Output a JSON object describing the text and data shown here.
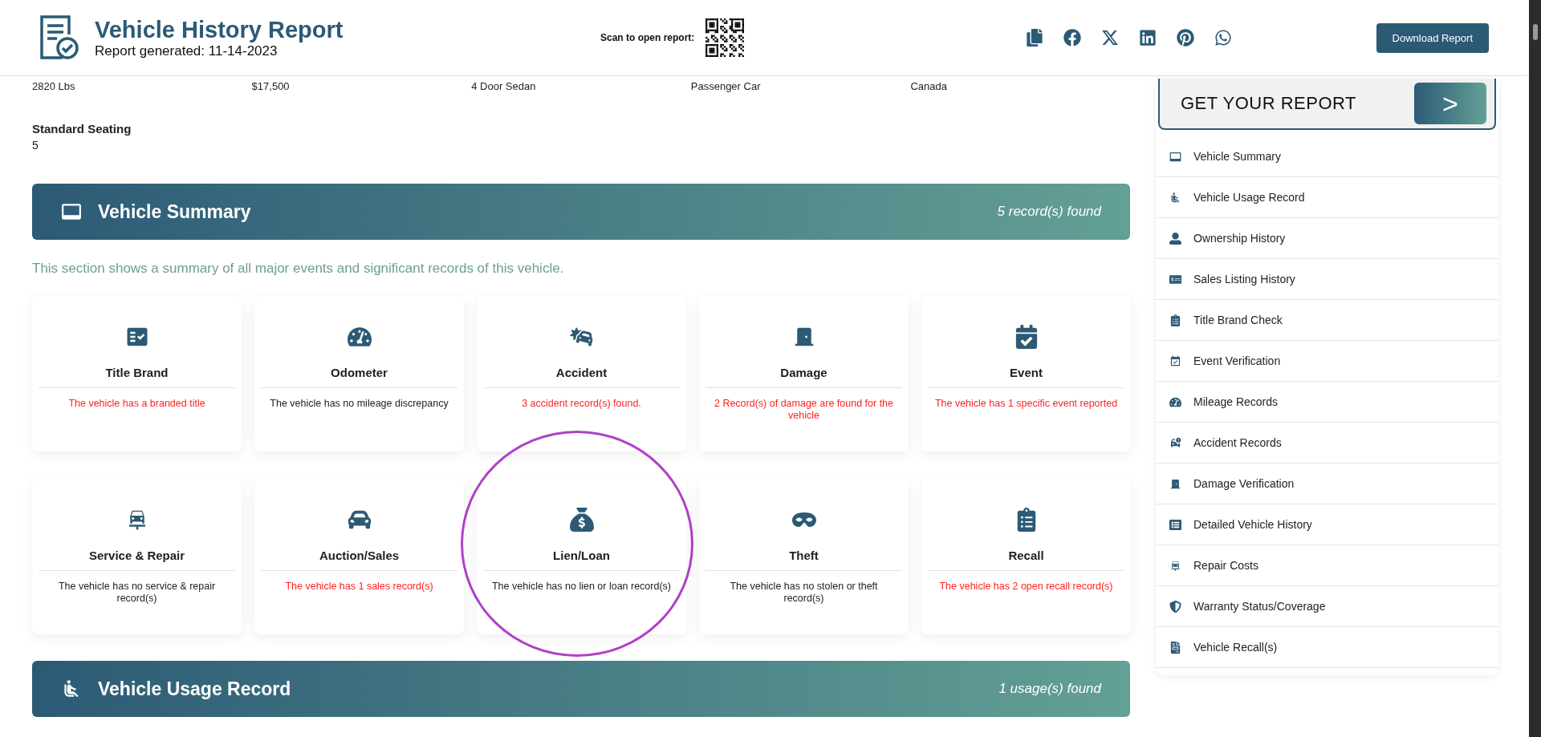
{
  "header": {
    "title": "Vehicle History Report",
    "generated": "Report generated: 11-14-2023",
    "qr_label": "Scan to open report:",
    "download_button": "Download Report"
  },
  "specs": [
    "2820 Lbs",
    "$17,500",
    "4 Door Sedan",
    "Passenger Car",
    "Canada"
  ],
  "seating": {
    "label": "Standard Seating",
    "value": "5"
  },
  "summary": {
    "title": "Vehicle Summary",
    "count": "5 record(s) found",
    "description": "This section shows a summary of all major events and significant records of this vehicle."
  },
  "cards": [
    {
      "title": "Title Brand",
      "text": "The vehicle has a branded title",
      "alert": true,
      "highlighted": false
    },
    {
      "title": "Odometer",
      "text": "The vehicle has no mileage discrepancy",
      "alert": false,
      "highlighted": false
    },
    {
      "title": "Accident",
      "text": "3 accident record(s) found.",
      "alert": true,
      "highlighted": false
    },
    {
      "title": "Damage",
      "text": "2 Record(s) of damage are found for the vehicle",
      "alert": true,
      "highlighted": false
    },
    {
      "title": "Event",
      "text": "The vehicle has 1 specific event reported",
      "alert": true,
      "highlighted": false
    },
    {
      "title": "Service & Repair",
      "text": "The vehicle has no service & repair record(s)",
      "alert": false,
      "highlighted": false
    },
    {
      "title": "Auction/Sales",
      "text": "The vehicle has 1 sales record(s)",
      "alert": true,
      "highlighted": false
    },
    {
      "title": "Lien/Loan",
      "text": "The vehicle has no lien or loan record(s)",
      "alert": false,
      "highlighted": true
    },
    {
      "title": "Theft",
      "text": "The vehicle has no stolen or theft record(s)",
      "alert": false,
      "highlighted": false
    },
    {
      "title": "Recall",
      "text": "The vehicle has 2 open recall record(s)",
      "alert": true,
      "highlighted": false
    }
  ],
  "usage": {
    "title": "Vehicle Usage Record",
    "count": "1 usage(s) found"
  },
  "sidebar": {
    "cta": "GET YOUR REPORT",
    "cta_button": ">",
    "items": [
      "Vehicle Summary",
      "Vehicle Usage Record",
      "Ownership History",
      "Sales Listing History",
      "Title Brand Check",
      "Event Verification",
      "Mileage Records",
      "Accident Records",
      "Damage Verification",
      "Detailed Vehicle History",
      "Repair Costs",
      "Warranty Status/Coverage",
      "Vehicle Recall(s)"
    ]
  }
}
